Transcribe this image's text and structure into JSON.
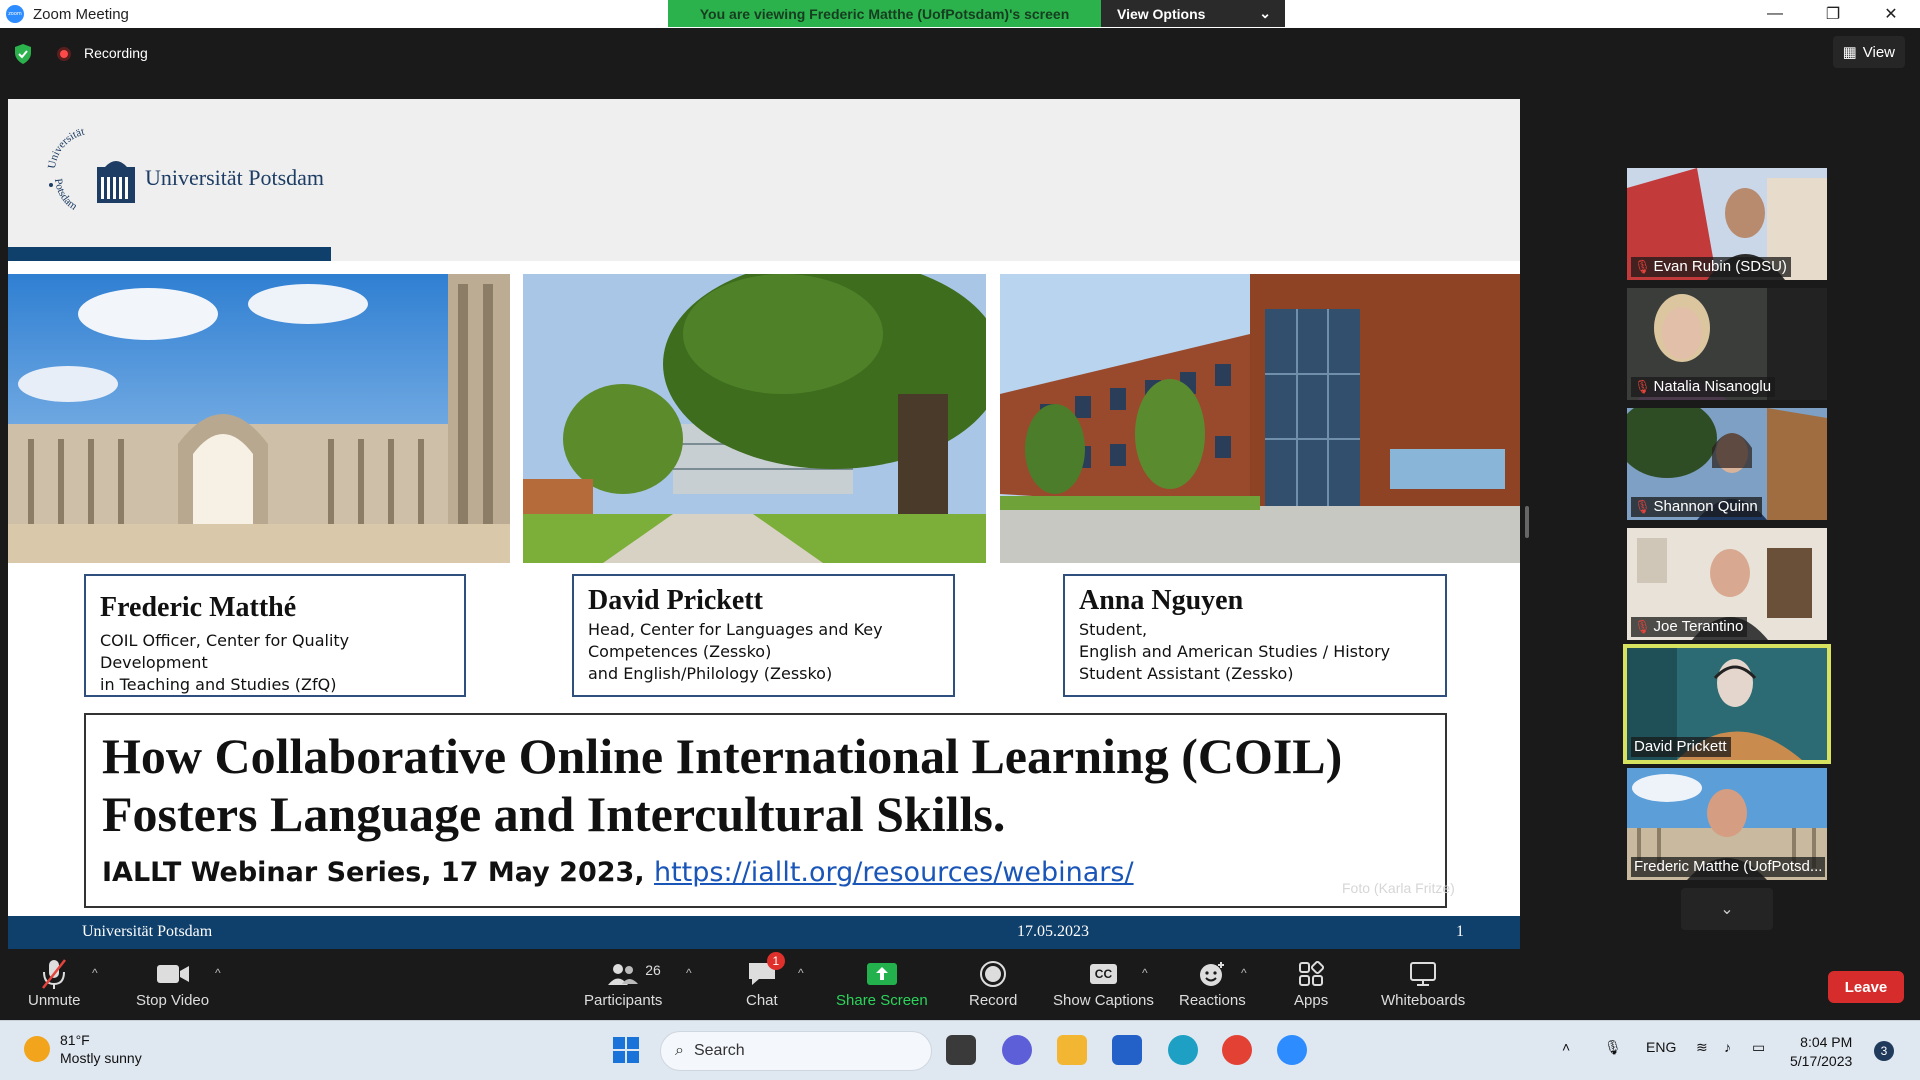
{
  "window": {
    "title": "Zoom Meeting",
    "app_logo_text": "zoom",
    "sharing_banner": "You are viewing Frederic Matthe (UofPotsdam)'s screen",
    "view_options": "View Options"
  },
  "meeting_bar": {
    "recording": "Recording",
    "view": "View"
  },
  "slide": {
    "university": "Universität Potsdam",
    "logo_arc_top": "Universität",
    "logo_arc_bottom": "Potsdam",
    "people": [
      {
        "name": "Frederic Matthé",
        "role": "COIL Officer, Center for Quality Development\nin Teaching and Studies (ZfQ)"
      },
      {
        "name": "David Prickett",
        "role": "Head, Center for Languages and Key\nCompetences (Zessko)\nand English/Philology (Zessko)"
      },
      {
        "name": "Anna Nguyen",
        "role": "Student,\nEnglish and American Studies / History\nStudent Assistant  (Zessko)"
      }
    ],
    "title_line1": "How Collaborative Online International Learning (COIL)",
    "title_line2": "Fosters Language and Intercultural Skills.",
    "subtitle": "IALLT Webinar Series, 17 May 2023, ",
    "link": "https://iallt.org/resources/webinars/",
    "photo_credit": "Foto (Karla Fritze)",
    "footer_left": "Universität Potsdam",
    "footer_date": "17.05.2023",
    "footer_page": "1"
  },
  "participants": [
    {
      "name": "Evan Rubin (SDSU)",
      "muted": true,
      "active": false
    },
    {
      "name": "Natalia Nisanoglu",
      "muted": true,
      "active": false
    },
    {
      "name": "Shannon Quinn",
      "muted": true,
      "active": false
    },
    {
      "name": "Joe Terantino",
      "muted": true,
      "active": false
    },
    {
      "name": "David Prickett",
      "muted": false,
      "active": true
    },
    {
      "name": "Frederic Matthe (UofPotsd...",
      "muted": false,
      "active": false
    }
  ],
  "toolbar": {
    "unmute": "Unmute",
    "stop_video": "Stop Video",
    "participants": "Participants",
    "participants_count": "26",
    "chat": "Chat",
    "chat_badge": "1",
    "share_screen": "Share Screen",
    "record": "Record",
    "show_captions": "Show Captions",
    "captions_icon": "CC",
    "reactions": "Reactions",
    "apps": "Apps",
    "whiteboards": "Whiteboards",
    "leave": "Leave"
  },
  "taskbar": {
    "temperature": "81°F",
    "weather": "Mostly sunny",
    "search": "Search",
    "language": "ENG",
    "time": "8:04 PM",
    "date": "5/17/2023",
    "notifications": "3"
  },
  "colors": {
    "banner_green": "#2bb24c",
    "slide_blue": "#0f3f6b",
    "leave_red": "#d72c2c",
    "active_speaker": "#d7e35f"
  }
}
